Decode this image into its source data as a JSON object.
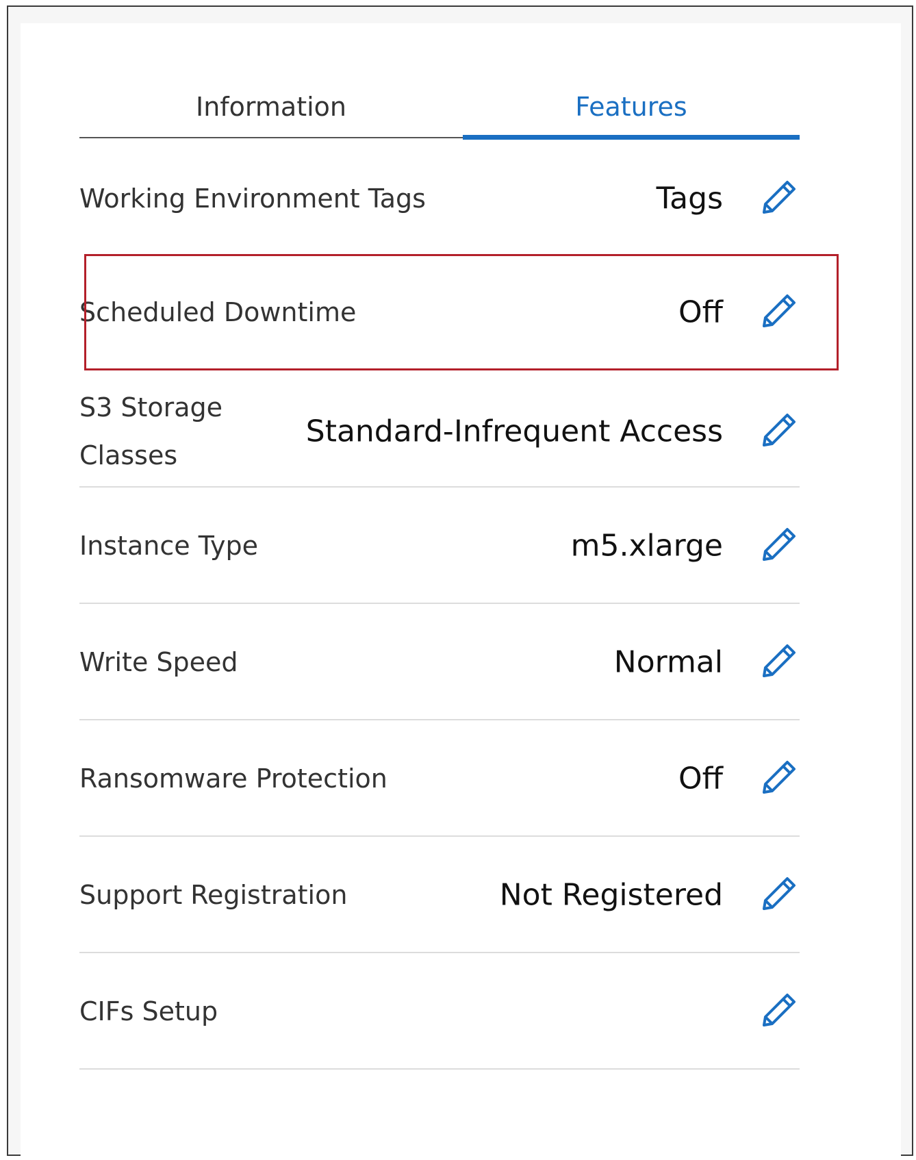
{
  "tabs": [
    {
      "label": "Information",
      "active": false
    },
    {
      "label": "Features",
      "active": true
    }
  ],
  "features": [
    {
      "label": "Working Environment Tags",
      "value": "Tags"
    },
    {
      "label": "Scheduled Downtime",
      "value": "Off"
    },
    {
      "label": "S3 Storage Classes",
      "value": "Standard-Infrequent Access"
    },
    {
      "label": "Instance Type",
      "value": "m5.xlarge"
    },
    {
      "label": "Write Speed",
      "value": "Normal"
    },
    {
      "label": "Ransomware Protection",
      "value": "Off"
    },
    {
      "label": "Support Registration",
      "value": "Not Registered"
    },
    {
      "label": "CIFs Setup",
      "value": ""
    }
  ],
  "icons": {
    "edit": "pencil-icon"
  },
  "colors": {
    "accent": "#1a6fc2",
    "highlight": "#b3202a",
    "divider": "#dcdcdc"
  }
}
